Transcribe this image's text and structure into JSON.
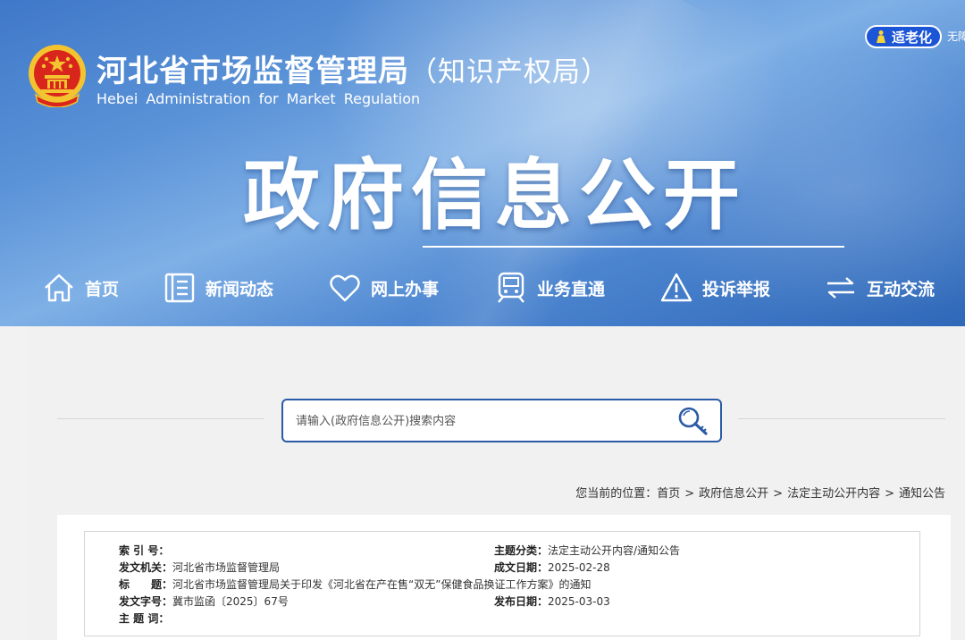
{
  "header": {
    "org_name_cn": "河北省市场监督管理局",
    "org_name_suffix": "（知识产权局）",
    "org_name_en": "Hebei Administration for Market Regulation",
    "elder_mode_label": "适老化",
    "accessibility_label": "无障",
    "hero_title": "政府信息公开"
  },
  "nav": {
    "items": [
      {
        "label": "首页",
        "icon": "home-icon"
      },
      {
        "label": "新闻动态",
        "icon": "document-list-icon"
      },
      {
        "label": "网上办事",
        "icon": "heart-icon"
      },
      {
        "label": "业务直通",
        "icon": "train-icon"
      },
      {
        "label": "投诉举报",
        "icon": "warning-icon"
      },
      {
        "label": "互动交流",
        "icon": "exchange-arrows-icon"
      }
    ]
  },
  "search": {
    "placeholder": "请输入(政府信息公开)搜索内容"
  },
  "breadcrumb": {
    "prefix": "您当前的位置：",
    "items": [
      "首页",
      "政府信息公开",
      "法定主动公开内容",
      "通知公告"
    ]
  },
  "info": {
    "index_label": "索 引 号：",
    "index_value": "",
    "category_label": "主题分类：",
    "category_value": "法定主动公开内容/通知公告",
    "issuer_label": "发文机关：",
    "issuer_value": "河北省市场监督管理局",
    "date_created_label": "成文日期：",
    "date_created_value": "2025-02-28",
    "title_label": "标　　题：",
    "title_value": "河北省市场监督管理局关于印发《河北省在产在售“双无”保健食品换证工作方案》的通知",
    "doc_no_label": "发文字号：",
    "doc_no_value": "冀市监函〔2025〕67号",
    "publish_date_label": "发布日期：",
    "publish_date_value": "2025-03-03",
    "keywords_label": "主 题 词：",
    "keywords_value": ""
  },
  "colors": {
    "banner_blue": "#3f78c8",
    "accent_dark_blue": "#2b5aa6",
    "elder_button": "#1c55d6"
  }
}
